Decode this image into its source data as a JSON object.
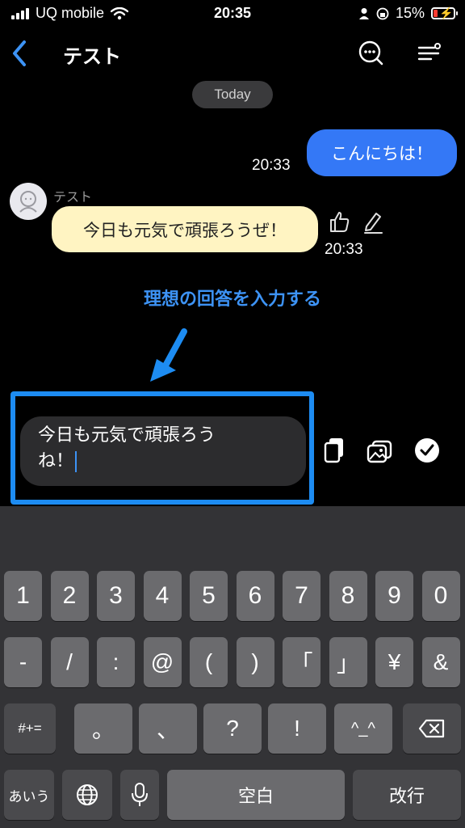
{
  "status_bar": {
    "carrier": "UQ mobile",
    "time": "20:35",
    "battery_percent": "15%",
    "battery_color": "#ff3b30"
  },
  "header": {
    "title": "テスト",
    "icons": [
      "back-chevron-icon",
      "search-chat-icon",
      "menu-filter-icon"
    ]
  },
  "chat": {
    "date_pill": "Today",
    "outgoing": {
      "text": "こんにちは！",
      "time": "20:33"
    },
    "incoming": {
      "sender": "テスト",
      "text": "今日も元気で頑張ろうぜ！",
      "time": "20:33"
    }
  },
  "annotation": {
    "text": "理想の回答を入力する"
  },
  "composer": {
    "line1": "今日も元気で頑張ろう",
    "line2": "ね！",
    "icons": [
      "copy-icon",
      "image-icon",
      "check-icon"
    ]
  },
  "keyboard": {
    "row1": [
      "1",
      "2",
      "3",
      "4",
      "5",
      "6",
      "7",
      "8",
      "9",
      "0"
    ],
    "row2": [
      "-",
      "/",
      ":",
      "@",
      "(",
      ")",
      "「",
      "」",
      "¥",
      "&"
    ],
    "row3": [
      "#+=",
      "。",
      "、",
      "?",
      "!",
      "^_^",
      "backspace-icon"
    ],
    "row4": {
      "kana": "あいう",
      "globe": "globe-icon",
      "mic": "microphone-icon",
      "space": "空白",
      "return": "改行"
    }
  },
  "colors": {
    "accent_blue": "#3478f6",
    "highlight_blue": "#1d8cf2",
    "incoming_bubble": "#fff4c2",
    "keyboard_bg": "#333336"
  }
}
